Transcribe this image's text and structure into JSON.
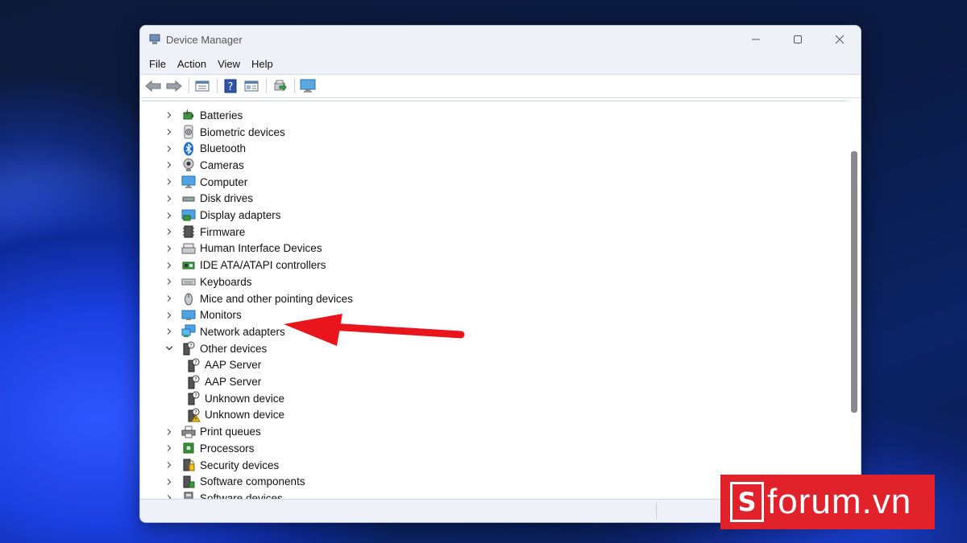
{
  "window": {
    "title": "Device Manager"
  },
  "menu": [
    "File",
    "Action",
    "View",
    "Help"
  ],
  "tree": [
    {
      "label": "Batteries",
      "icon": "battery-icon",
      "expanded": false,
      "child": false
    },
    {
      "label": "Biometric devices",
      "icon": "fingerprint-icon",
      "expanded": false,
      "child": false
    },
    {
      "label": "Bluetooth",
      "icon": "bluetooth-icon",
      "expanded": false,
      "child": false
    },
    {
      "label": "Cameras",
      "icon": "camera-icon",
      "expanded": false,
      "child": false
    },
    {
      "label": "Computer",
      "icon": "computer-icon",
      "expanded": false,
      "child": false
    },
    {
      "label": "Disk drives",
      "icon": "disk-drive-icon",
      "expanded": false,
      "child": false
    },
    {
      "label": "Display adapters",
      "icon": "display-adapter-icon",
      "expanded": false,
      "child": false
    },
    {
      "label": "Firmware",
      "icon": "firmware-icon",
      "expanded": false,
      "child": false
    },
    {
      "label": "Human Interface Devices",
      "icon": "hid-icon",
      "expanded": false,
      "child": false
    },
    {
      "label": "IDE ATA/ATAPI controllers",
      "icon": "ide-controller-icon",
      "expanded": false,
      "child": false
    },
    {
      "label": "Keyboards",
      "icon": "keyboard-icon",
      "expanded": false,
      "child": false
    },
    {
      "label": "Mice and other pointing devices",
      "icon": "mouse-icon",
      "expanded": false,
      "child": false
    },
    {
      "label": "Monitors",
      "icon": "monitor-icon",
      "expanded": false,
      "child": false
    },
    {
      "label": "Network adapters",
      "icon": "network-adapter-icon",
      "expanded": false,
      "child": false
    },
    {
      "label": "Other devices",
      "icon": "unknown-device-icon",
      "expanded": true,
      "child": false
    },
    {
      "label": "AAP Server",
      "icon": "unknown-device-icon",
      "expanded": false,
      "child": true
    },
    {
      "label": "AAP Server",
      "icon": "unknown-device-icon",
      "expanded": false,
      "child": true
    },
    {
      "label": "Unknown device",
      "icon": "unknown-device-icon",
      "expanded": false,
      "child": true
    },
    {
      "label": "Unknown device",
      "icon": "warning-device-icon",
      "expanded": false,
      "child": true
    },
    {
      "label": "Print queues",
      "icon": "printer-icon",
      "expanded": false,
      "child": false
    },
    {
      "label": "Processors",
      "icon": "processor-icon",
      "expanded": false,
      "child": false
    },
    {
      "label": "Security devices",
      "icon": "security-device-icon",
      "expanded": false,
      "child": false
    },
    {
      "label": "Software components",
      "icon": "software-component-icon",
      "expanded": false,
      "child": false
    },
    {
      "label": "Software devices",
      "icon": "software-device-icon",
      "expanded": false,
      "child": false
    }
  ],
  "logo": {
    "box_letter": "S",
    "text": "forum.vn"
  }
}
